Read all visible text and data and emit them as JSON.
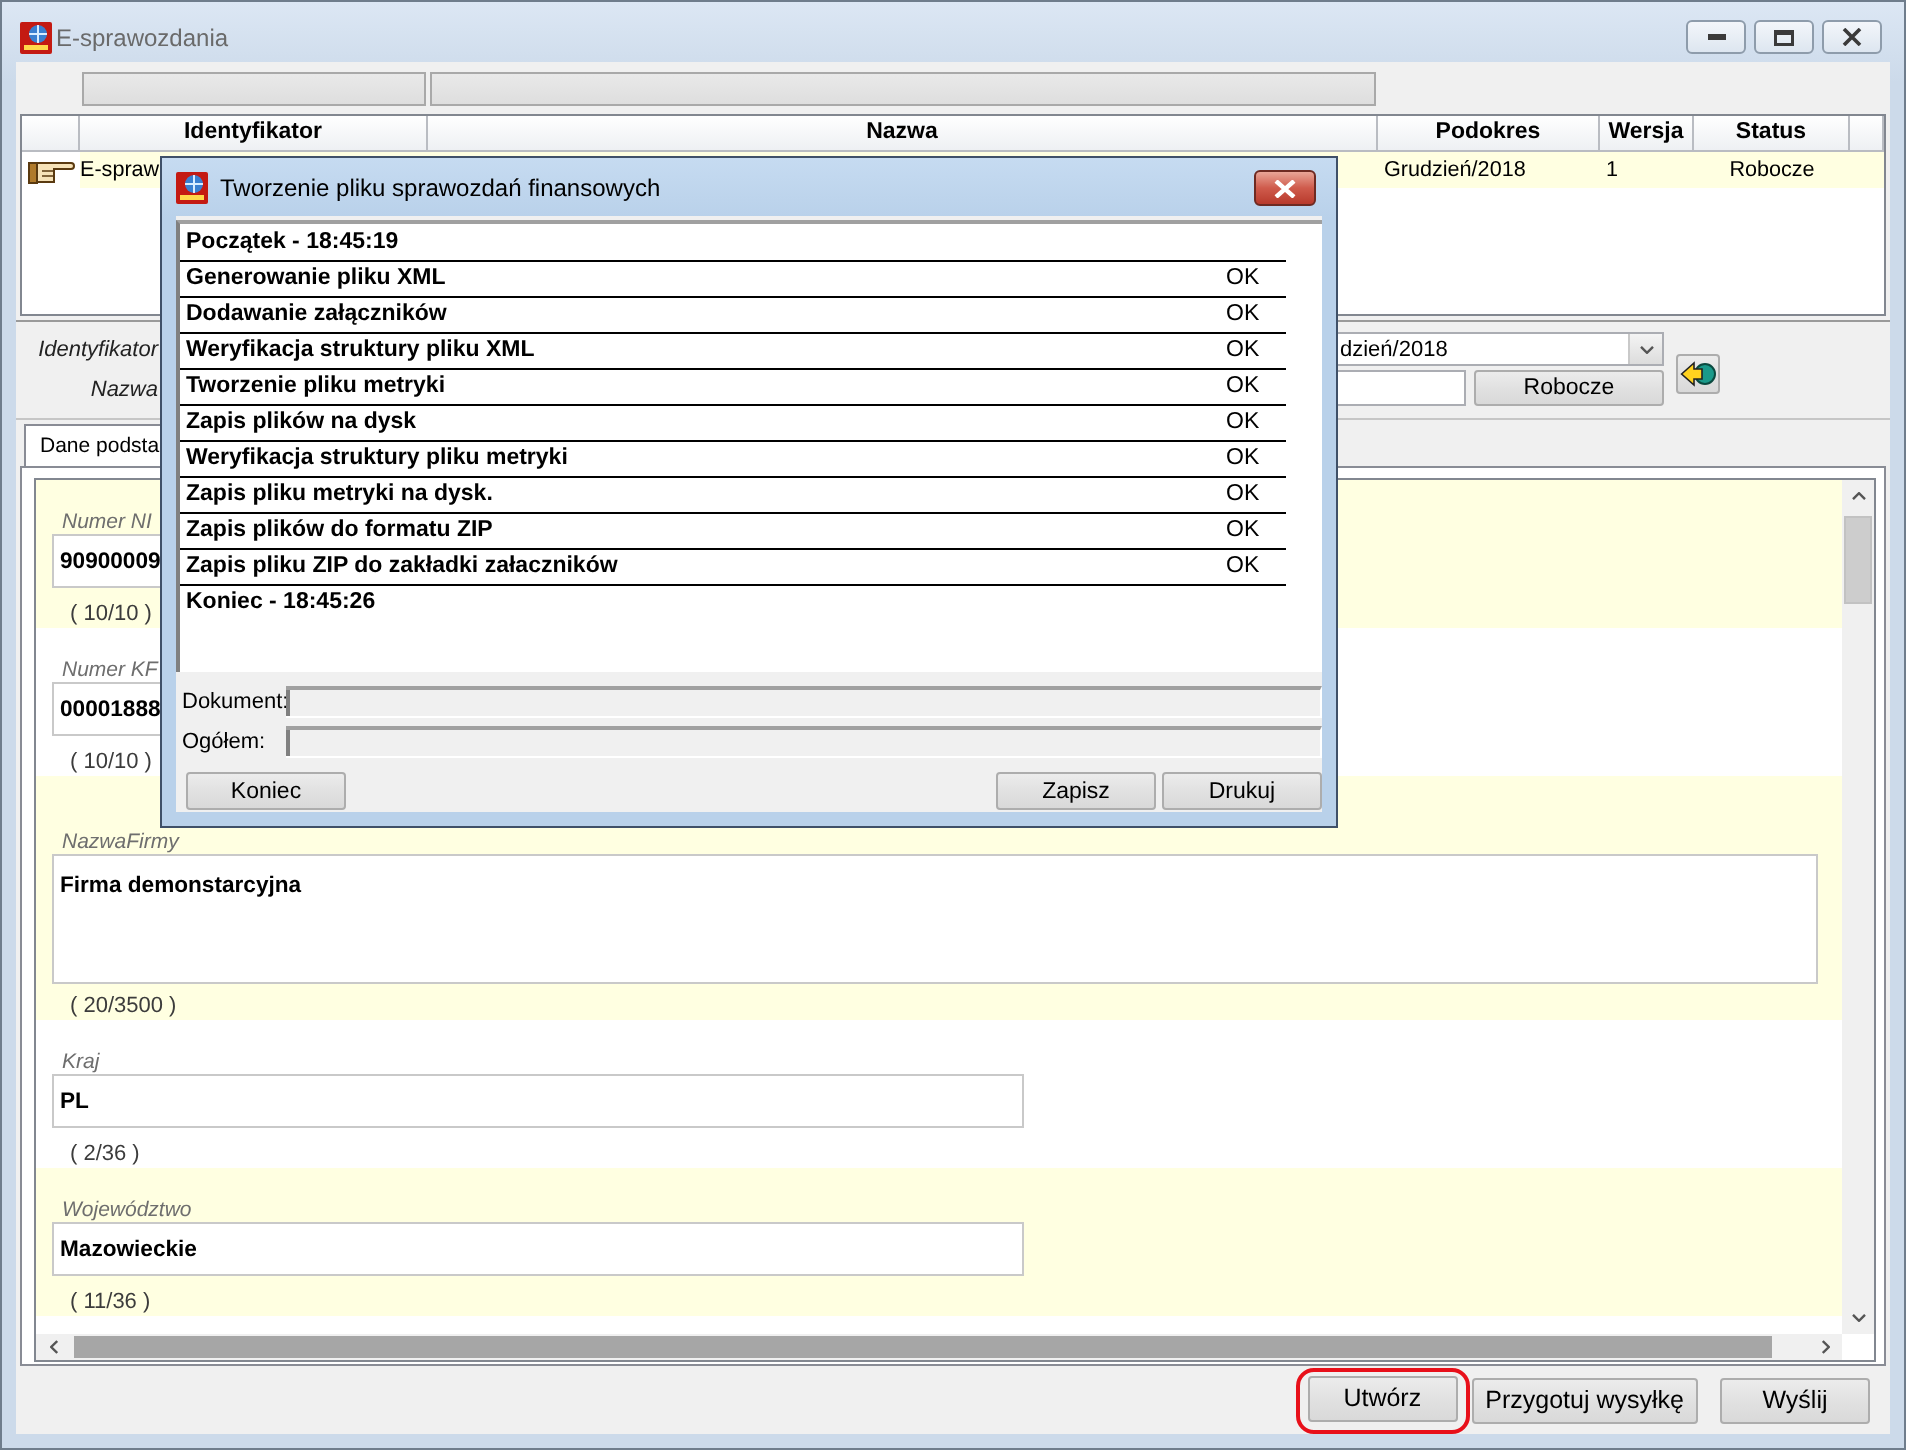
{
  "window": {
    "title": "E-sprawozdania"
  },
  "table": {
    "columns": [
      {
        "label": "Identyfikator",
        "filter": true
      },
      {
        "label": "Nazwa",
        "filter": true
      },
      {
        "label": "Podokres",
        "filter": false
      },
      {
        "label": "Wersja",
        "filter": false
      },
      {
        "label": "Status",
        "filter": false
      }
    ],
    "rows": [
      {
        "selected": true,
        "identyfikator": "E-spraw",
        "podokres": "Grudzień/2018",
        "wersja": "1",
        "status": "Robocze"
      }
    ]
  },
  "details": {
    "identifier_label": "Identyfikator",
    "name_label": "Nazwa",
    "period": "dzień/2018",
    "status_button": "Robocze"
  },
  "tabs": [
    {
      "label": "Dane podsta",
      "selected": true
    }
  ],
  "form_fields": [
    {
      "kind": "single",
      "label": "Numer NI",
      "value": "90900009",
      "counter": "( 10/10 )"
    },
    {
      "kind": "single",
      "label": "Numer KF",
      "value": "00001888",
      "counter": "( 10/10 )"
    },
    {
      "kind": "multiline",
      "label": "NazwaFirmy",
      "value": "Firma demonstarcyjna",
      "counter": "( 20/3500 )"
    },
    {
      "kind": "single",
      "label": "Kraj",
      "value": "PL",
      "counter": "( 2/36 )"
    },
    {
      "kind": "single",
      "label": "Województwo",
      "value": "Mazowieckie",
      "counter": "( 11/36 )"
    }
  ],
  "footer_buttons": [
    {
      "label": "Utwórz",
      "highlighted": true
    },
    {
      "label": "Przygotuj wysyłkę",
      "highlighted": false
    },
    {
      "label": "Wyślij",
      "highlighted": false
    }
  ],
  "dialog": {
    "title": "Tworzenie pliku sprawozdań finansowych",
    "log": [
      {
        "text": "Początek - 18:45:19"
      },
      {
        "text": "Generowanie pliku XML",
        "result": "OK"
      },
      {
        "text": "Dodawanie załączników",
        "result": "OK"
      },
      {
        "text": "Weryfikacja struktury pliku XML",
        "result": "OK"
      },
      {
        "text": "Tworzenie pliku metryki",
        "result": "OK"
      },
      {
        "text": "Zapis plików na dysk",
        "result": "OK"
      },
      {
        "text": "Weryfikacja struktury pliku metryki",
        "result": "OK"
      },
      {
        "text": "Zapis pliku metryki na dysk.",
        "result": "OK"
      },
      {
        "text": "Zapis plików do formatu ZIP",
        "result": "OK"
      },
      {
        "text": "Zapis pliku ZIP do zakładki załaczników",
        "result": "OK"
      },
      {
        "text": "Koniec - 18:45:26"
      }
    ],
    "progress": [
      {
        "label": "Dokument:",
        "level": 0
      },
      {
        "label": "Ogółem:",
        "level": 0
      }
    ],
    "buttons": [
      {
        "label": "Koniec"
      },
      {
        "label": "Zapisz"
      },
      {
        "label": "Drukuj"
      }
    ]
  }
}
